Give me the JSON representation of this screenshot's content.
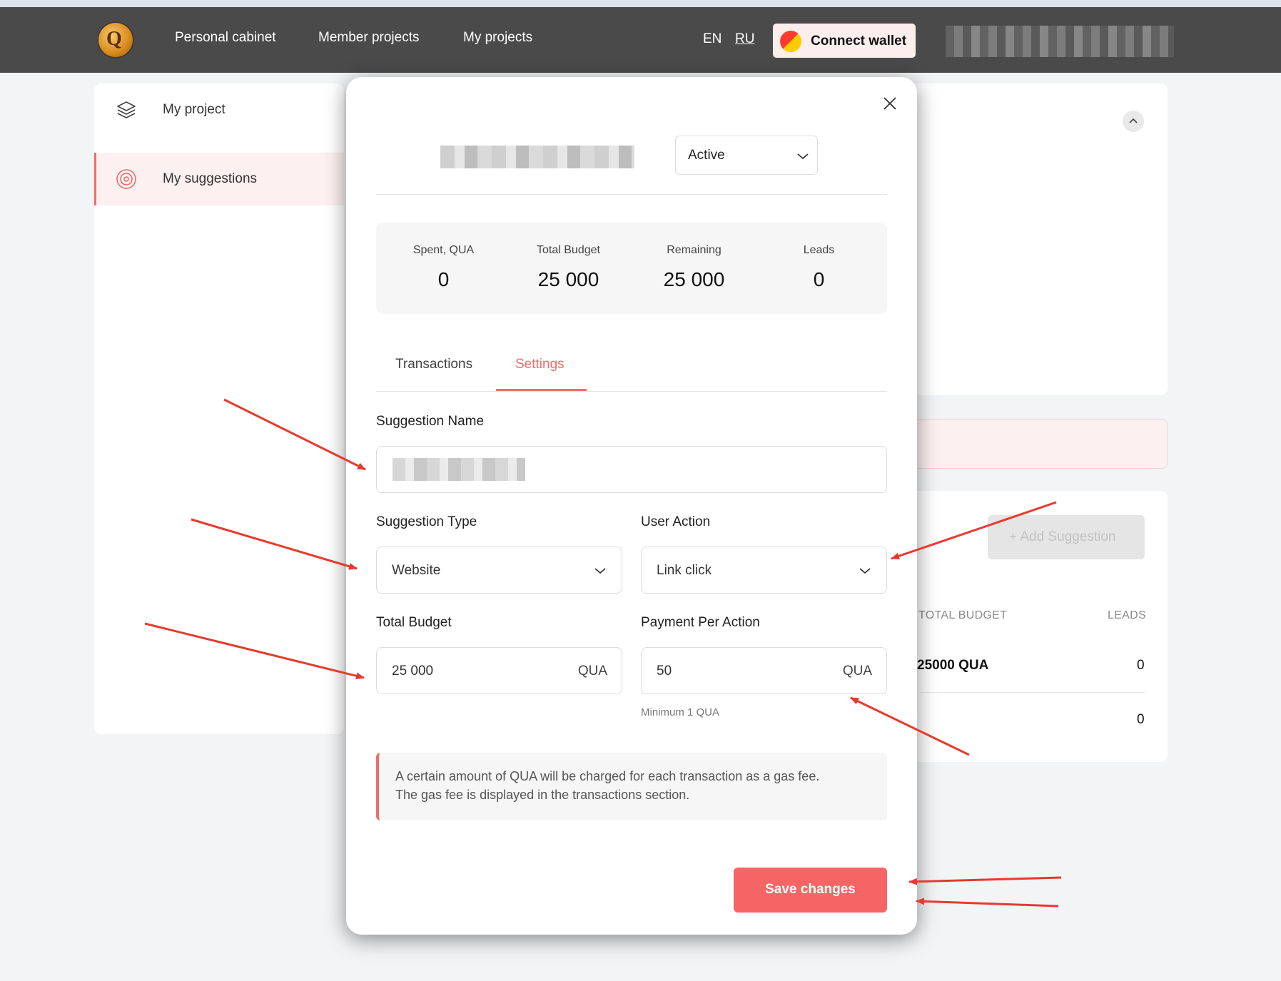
{
  "navbar": {
    "logo_letter": "Q",
    "links": [
      "Personal cabinet",
      "Member projects",
      "My projects"
    ],
    "lang_en": "EN",
    "lang_ru": "RU",
    "connect_wallet": "Connect wallet"
  },
  "sidebar": {
    "items": [
      {
        "label": "My project",
        "icon": "layers-icon"
      },
      {
        "label": "My suggestions",
        "icon": "target-icon"
      }
    ]
  },
  "background": {
    "add_suggestion": "Add Suggestion",
    "table": {
      "headers": [
        "TOTAL BUDGET",
        "LEADS"
      ],
      "rows": [
        {
          "budget": "25000 QUA",
          "leads": "0"
        },
        {
          "budget": "",
          "leads": "0"
        }
      ]
    }
  },
  "modal": {
    "status": "Active",
    "stats": [
      {
        "label": "Spent, QUA",
        "value": "0"
      },
      {
        "label": "Total Budget",
        "value": "25 000"
      },
      {
        "label": "Remaining",
        "value": "25 000"
      },
      {
        "label": "Leads",
        "value": "0"
      }
    ],
    "tabs": [
      {
        "label": "Transactions",
        "active": false
      },
      {
        "label": "Settings",
        "active": true
      }
    ],
    "form": {
      "suggestion_name_label": "Suggestion Name",
      "suggestion_type_label": "Suggestion Type",
      "suggestion_type_value": "Website",
      "user_action_label": "User Action",
      "user_action_value": "Link click",
      "total_budget_label": "Total Budget",
      "total_budget_value": "25 000",
      "payment_label": "Payment Per Action",
      "payment_value": "50",
      "unit": "QUA",
      "payment_hint": "Minimum 1 QUA"
    },
    "note_line1": "A certain amount of QUA will be charged for each transaction as a gas fee.",
    "note_line2": "The gas fee is displayed in the transactions section.",
    "save_label": "Save changes"
  },
  "colors": {
    "accent": "#f26b6b",
    "navbar": "#4a4a4a",
    "annotation_arrow": "#e8392e"
  }
}
